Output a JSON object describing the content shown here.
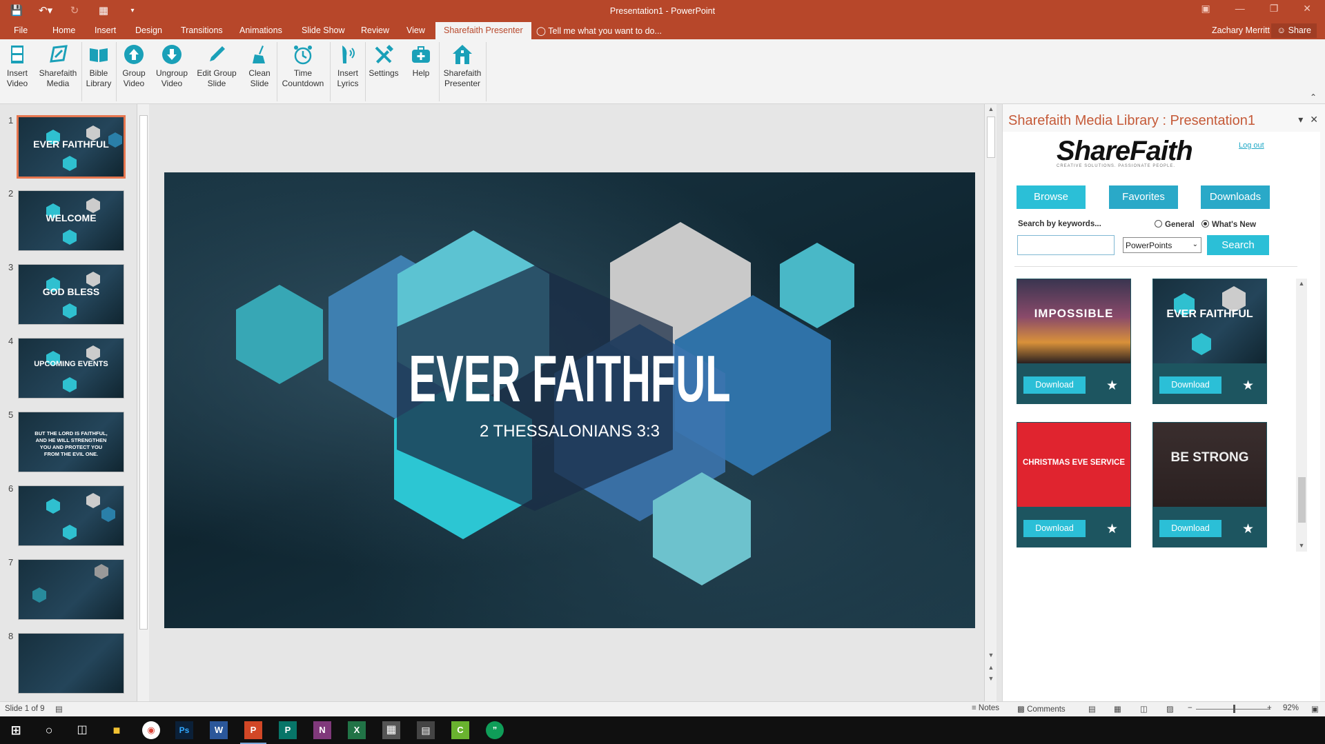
{
  "window": {
    "title": "Presentation1 - PowerPoint",
    "user": "Zachary Merritt",
    "share": "Share"
  },
  "tabs": [
    "File",
    "Home",
    "Insert",
    "Design",
    "Transitions",
    "Animations",
    "Slide Show",
    "Review",
    "View",
    "Sharefaith Presenter"
  ],
  "tell_me": "Tell me what you want to do...",
  "ribbon": [
    {
      "label": "Insert\nVideo",
      "icon": "film-icon"
    },
    {
      "label": "Sharefaith\nMedia",
      "icon": "sharefaith-media-icon"
    },
    {
      "label": "Bible\nLibrary",
      "icon": "book-icon"
    },
    {
      "label": "Group\nVideo",
      "icon": "upload-circle-icon"
    },
    {
      "label": "Ungroup\nVideo",
      "icon": "download-circle-icon"
    },
    {
      "label": "Edit Group\nSlide",
      "icon": "pencil-icon"
    },
    {
      "label": "Clean\nSlide",
      "icon": "broom-icon"
    },
    {
      "label": "Time\nCountdown",
      "icon": "alarm-clock-icon"
    },
    {
      "label": "Insert\nLyrics",
      "icon": "singer-icon"
    },
    {
      "label": "Settings",
      "icon": "tools-icon"
    },
    {
      "label": "Help",
      "icon": "first-aid-icon"
    },
    {
      "label": "Sharefaith\nPresenter",
      "icon": "home-icon"
    }
  ],
  "thumbnails": [
    {
      "num": "1",
      "label": "EVER FAITHFUL"
    },
    {
      "num": "2",
      "label": "WELCOME"
    },
    {
      "num": "3",
      "label": "GOD BLESS"
    },
    {
      "num": "4",
      "label": "UPCOMING EVENTS"
    },
    {
      "num": "5",
      "label": "BUT THE LORD IS FAITHFUL, AND HE WILL STRENGTHEN YOU AND PROTECT YOU FROM THE EVIL ONE."
    },
    {
      "num": "6",
      "label": ""
    },
    {
      "num": "7",
      "label": ""
    },
    {
      "num": "8",
      "label": ""
    }
  ],
  "slide": {
    "title": "EVER FAITHFUL",
    "subtitle": "2 THESSALONIANS 3:3"
  },
  "panel": {
    "title": "Sharefaith Media Library : Presentation1",
    "logo": "ShareFaith",
    "logo_tagline": "CREATIVE SOLUTIONS. PASSIONATE PEOPLE.",
    "logout": "Log out",
    "browse": "Browse",
    "favorites": "Favorites",
    "downloads": "Downloads",
    "search_label": "Search by keywords...",
    "radio_general": "General",
    "radio_whats_new": "What's New",
    "search_value": "",
    "select_value": "PowerPoints",
    "search_button": "Search",
    "cards": [
      {
        "title": "IMPOSSIBLE",
        "download": "Download"
      },
      {
        "title": "EVER FAITHFUL",
        "download": "Download"
      },
      {
        "title": "CHRISTMAS EVE SERVICE",
        "download": "Download"
      },
      {
        "title": "BE STRONG",
        "download": "Download"
      }
    ]
  },
  "status": {
    "slide_of": "Slide 1 of 9",
    "notes": "Notes",
    "comments": "Comments",
    "zoom": "92%"
  },
  "colors": {
    "accent": "#b7472a",
    "sharefaith_button": "#2bbfd7",
    "card_bg": "#1d5560"
  }
}
